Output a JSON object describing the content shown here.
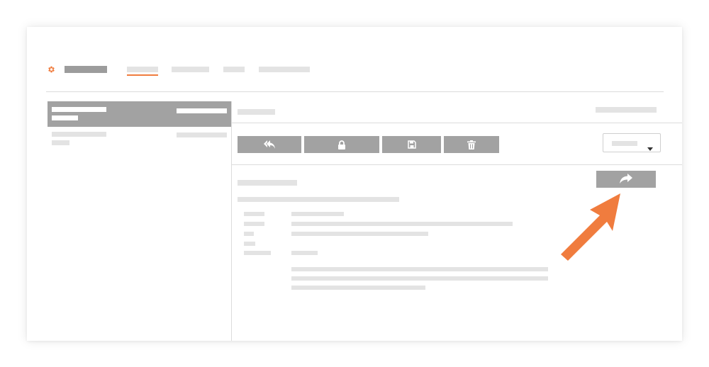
{
  "colors": {
    "accent": "#f07c3e",
    "button_gray": "#a2a2a2",
    "placeholder_gray": "#e3e3e3",
    "divider": "#dcdcdc"
  },
  "header": {
    "logo_icon": "gear-icon",
    "tabs": [
      {
        "id": "tab-1",
        "active": true
      },
      {
        "id": "tab-2",
        "active": false
      },
      {
        "id": "tab-3",
        "active": false
      },
      {
        "id": "tab-4",
        "active": false
      }
    ]
  },
  "toolbar": {
    "buttons": [
      {
        "name": "reply-all-button",
        "icon": "reply-all-icon"
      },
      {
        "name": "lock-button",
        "icon": "lock-icon"
      },
      {
        "name": "save-button",
        "icon": "floppy-disk-icon"
      },
      {
        "name": "delete-button",
        "icon": "trash-icon"
      }
    ],
    "dropdown_icon": "caret-down-icon",
    "forward_icon": "forward-arrow-icon"
  },
  "annotation": {
    "icon": "callout-arrow",
    "color": "#f07c3e"
  }
}
